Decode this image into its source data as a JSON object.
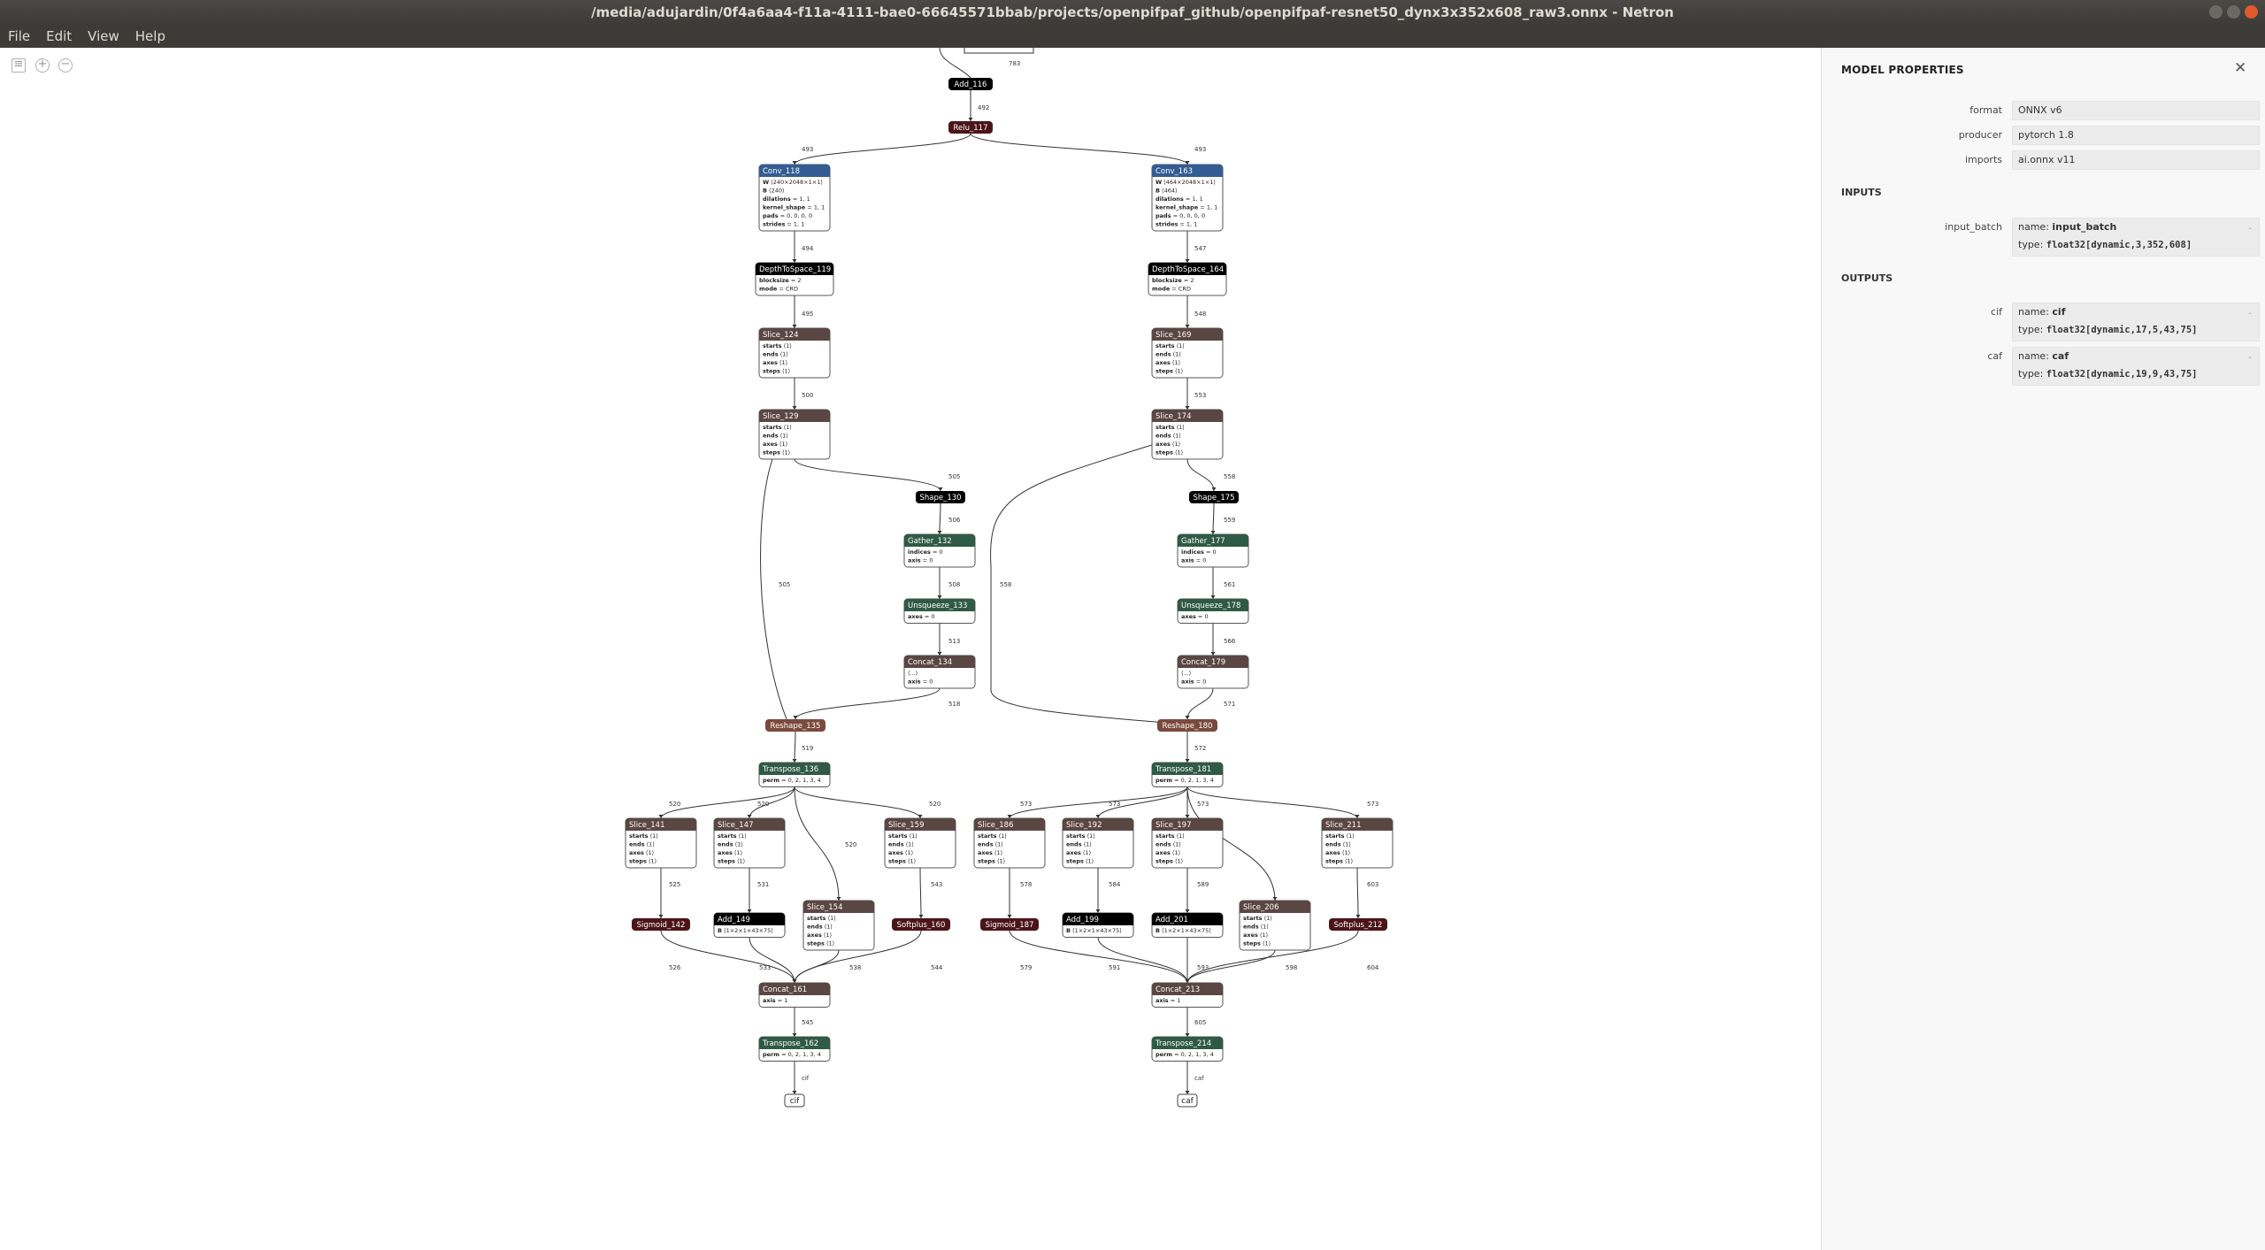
{
  "window": {
    "title": "/media/adujardin/0f4a6aa4-f11a-4111-bae0-66645571bbab/projects/openpifpaf_github/openpifpaf-resnet50_dynx3x352x608_raw3.onnx - Netron"
  },
  "menu": [
    "File",
    "Edit",
    "View",
    "Help"
  ],
  "colors": {
    "layer": "#335c93",
    "shape": "#7a4a3d",
    "tensor": "#2f5a45",
    "activation": "#4b1518",
    "black": "#000000",
    "dark": "#5a4642"
  },
  "graph": {
    "nodes": [
      {
        "id": "add116",
        "label": "Add_116",
        "kind": "black",
        "attrs": []
      },
      {
        "id": "relu117",
        "label": "Relu_117",
        "kind": "activation",
        "attrs": []
      },
      {
        "id": "conv118",
        "label": "Conv_118",
        "kind": "layer",
        "attrs": [
          [
            "W",
            "⟨240×2048×1×1⟩"
          ],
          [
            "B",
            "⟨240⟩"
          ],
          [
            "dilations",
            "1, 1"
          ],
          [
            "kernel_shape",
            "1, 1"
          ],
          [
            "pads",
            "0, 0, 0, 0"
          ],
          [
            "strides",
            "1, 1"
          ]
        ]
      },
      {
        "id": "conv163",
        "label": "Conv_163",
        "kind": "layer",
        "attrs": [
          [
            "W",
            "⟨464×2048×1×1⟩"
          ],
          [
            "B",
            "⟨464⟩"
          ],
          [
            "dilations",
            "1, 1"
          ],
          [
            "kernel_shape",
            "1, 1"
          ],
          [
            "pads",
            "0, 0, 0, 0"
          ],
          [
            "strides",
            "1, 1"
          ]
        ]
      },
      {
        "id": "d2s119",
        "label": "DepthToSpace_119",
        "kind": "black",
        "attrs": [
          [
            "blocksize",
            "2"
          ],
          [
            "mode",
            "CRD"
          ]
        ]
      },
      {
        "id": "d2s164",
        "label": "DepthToSpace_164",
        "kind": "black",
        "attrs": [
          [
            "blocksize",
            "2"
          ],
          [
            "mode",
            "CRD"
          ]
        ]
      },
      {
        "id": "slice124",
        "label": "Slice_124",
        "kind": "dark",
        "attrs": [
          [
            "starts",
            "⟨1⟩"
          ],
          [
            "ends",
            "⟨1⟩"
          ],
          [
            "axes",
            "⟨1⟩"
          ],
          [
            "steps",
            "⟨1⟩"
          ]
        ]
      },
      {
        "id": "slice169",
        "label": "Slice_169",
        "kind": "dark",
        "attrs": [
          [
            "starts",
            "⟨1⟩"
          ],
          [
            "ends",
            "⟨1⟩"
          ],
          [
            "axes",
            "⟨1⟩"
          ],
          [
            "steps",
            "⟨1⟩"
          ]
        ]
      },
      {
        "id": "slice129",
        "label": "Slice_129",
        "kind": "dark",
        "attrs": [
          [
            "starts",
            "⟨1⟩"
          ],
          [
            "ends",
            "⟨1⟩"
          ],
          [
            "axes",
            "⟨1⟩"
          ],
          [
            "steps",
            "⟨1⟩"
          ]
        ]
      },
      {
        "id": "slice174",
        "label": "Slice_174",
        "kind": "dark",
        "attrs": [
          [
            "starts",
            "⟨1⟩"
          ],
          [
            "ends",
            "⟨1⟩"
          ],
          [
            "axes",
            "⟨1⟩"
          ],
          [
            "steps",
            "⟨1⟩"
          ]
        ]
      },
      {
        "id": "shape130",
        "label": "Shape_130",
        "kind": "black",
        "attrs": []
      },
      {
        "id": "shape175",
        "label": "Shape_175",
        "kind": "black",
        "attrs": []
      },
      {
        "id": "gather132",
        "label": "Gather_132",
        "kind": "tensor",
        "attrs": [
          [
            "indices",
            "0"
          ],
          [
            "axis",
            "0"
          ]
        ]
      },
      {
        "id": "gather177",
        "label": "Gather_177",
        "kind": "tensor",
        "attrs": [
          [
            "indices",
            "0"
          ],
          [
            "axis",
            "0"
          ]
        ]
      },
      {
        "id": "unsq133",
        "label": "Unsqueeze_133",
        "kind": "tensor",
        "attrs": [
          [
            "axes",
            "0"
          ]
        ]
      },
      {
        "id": "unsq178",
        "label": "Unsqueeze_178",
        "kind": "tensor",
        "attrs": [
          [
            "axes",
            "0"
          ]
        ]
      },
      {
        "id": "concat134",
        "label": "Concat_134",
        "kind": "dark",
        "attrs": [
          [
            "",
            "⟨...⟩"
          ],
          [
            "axis",
            "0"
          ]
        ]
      },
      {
        "id": "concat179",
        "label": "Concat_179",
        "kind": "dark",
        "attrs": [
          [
            "",
            "⟨...⟩"
          ],
          [
            "axis",
            "0"
          ]
        ]
      },
      {
        "id": "reshape135",
        "label": "Reshape_135",
        "kind": "shape",
        "attrs": []
      },
      {
        "id": "reshape180",
        "label": "Reshape_180",
        "kind": "shape",
        "attrs": []
      },
      {
        "id": "transpose136",
        "label": "Transpose_136",
        "kind": "tensor",
        "attrs": [
          [
            "perm",
            "0, 2, 1, 3, 4"
          ]
        ]
      },
      {
        "id": "transpose181",
        "label": "Transpose_181",
        "kind": "tensor",
        "attrs": [
          [
            "perm",
            "0, 2, 1, 3, 4"
          ]
        ]
      },
      {
        "id": "slice141",
        "label": "Slice_141",
        "kind": "dark",
        "attrs": [
          [
            "starts",
            "⟨1⟩"
          ],
          [
            "ends",
            "⟨1⟩"
          ],
          [
            "axes",
            "⟨1⟩"
          ],
          [
            "steps",
            "⟨1⟩"
          ]
        ]
      },
      {
        "id": "slice147",
        "label": "Slice_147",
        "kind": "dark",
        "attrs": [
          [
            "starts",
            "⟨1⟩"
          ],
          [
            "ends",
            "⟨1⟩"
          ],
          [
            "axes",
            "⟨1⟩"
          ],
          [
            "steps",
            "⟨1⟩"
          ]
        ]
      },
      {
        "id": "slice159",
        "label": "Slice_159",
        "kind": "dark",
        "attrs": [
          [
            "starts",
            "⟨1⟩"
          ],
          [
            "ends",
            "⟨1⟩"
          ],
          [
            "axes",
            "⟨1⟩"
          ],
          [
            "steps",
            "⟨1⟩"
          ]
        ]
      },
      {
        "id": "slice154",
        "label": "Slice_154",
        "kind": "dark",
        "attrs": [
          [
            "starts",
            "⟨1⟩"
          ],
          [
            "ends",
            "⟨1⟩"
          ],
          [
            "axes",
            "⟨1⟩"
          ],
          [
            "steps",
            "⟨1⟩"
          ]
        ]
      },
      {
        "id": "slice186",
        "label": "Slice_186",
        "kind": "dark",
        "attrs": [
          [
            "starts",
            "⟨1⟩"
          ],
          [
            "ends",
            "⟨1⟩"
          ],
          [
            "axes",
            "⟨1⟩"
          ],
          [
            "steps",
            "⟨1⟩"
          ]
        ]
      },
      {
        "id": "slice192",
        "label": "Slice_192",
        "kind": "dark",
        "attrs": [
          [
            "starts",
            "⟨1⟩"
          ],
          [
            "ends",
            "⟨1⟩"
          ],
          [
            "axes",
            "⟨1⟩"
          ],
          [
            "steps",
            "⟨1⟩"
          ]
        ]
      },
      {
        "id": "slice197",
        "label": "Slice_197",
        "kind": "dark",
        "attrs": [
          [
            "starts",
            "⟨1⟩"
          ],
          [
            "ends",
            "⟨1⟩"
          ],
          [
            "axes",
            "⟨1⟩"
          ],
          [
            "steps",
            "⟨1⟩"
          ]
        ]
      },
      {
        "id": "slice211",
        "label": "Slice_211",
        "kind": "dark",
        "attrs": [
          [
            "starts",
            "⟨1⟩"
          ],
          [
            "ends",
            "⟨1⟩"
          ],
          [
            "axes",
            "⟨1⟩"
          ],
          [
            "steps",
            "⟨1⟩"
          ]
        ]
      },
      {
        "id": "slice206",
        "label": "Slice_206",
        "kind": "dark",
        "attrs": [
          [
            "starts",
            "⟨1⟩"
          ],
          [
            "ends",
            "⟨1⟩"
          ],
          [
            "axes",
            "⟨1⟩"
          ],
          [
            "steps",
            "⟨1⟩"
          ]
        ]
      },
      {
        "id": "sigmoid142",
        "label": "Sigmoid_142",
        "kind": "activation",
        "attrs": []
      },
      {
        "id": "add149",
        "label": "Add_149",
        "kind": "black",
        "attrs": [
          [
            "B",
            "⟨1×2×1×43×75⟩"
          ]
        ]
      },
      {
        "id": "softplus160",
        "label": "Softplus_160",
        "kind": "activation",
        "attrs": []
      },
      {
        "id": "sigmoid187",
        "label": "Sigmoid_187",
        "kind": "activation",
        "attrs": []
      },
      {
        "id": "add199",
        "label": "Add_199",
        "kind": "black",
        "attrs": [
          [
            "B",
            "⟨1×2×1×43×75⟩"
          ]
        ]
      },
      {
        "id": "add201",
        "label": "Add_201",
        "kind": "black",
        "attrs": [
          [
            "B",
            "⟨1×2×1×43×75⟩"
          ]
        ]
      },
      {
        "id": "softplus212",
        "label": "Softplus_212",
        "kind": "activation",
        "attrs": []
      },
      {
        "id": "concat161",
        "label": "Concat_161",
        "kind": "dark",
        "attrs": [
          [
            "axis",
            "1"
          ]
        ]
      },
      {
        "id": "concat213",
        "label": "Concat_213",
        "kind": "dark",
        "attrs": [
          [
            "axis",
            "1"
          ]
        ]
      },
      {
        "id": "transpose162",
        "label": "Transpose_162",
        "kind": "tensor",
        "attrs": [
          [
            "perm",
            "0, 2, 1, 3, 4"
          ]
        ]
      },
      {
        "id": "transpose214",
        "label": "Transpose_214",
        "kind": "tensor",
        "attrs": [
          [
            "perm",
            "0, 2, 1, 3, 4"
          ]
        ]
      },
      {
        "id": "out_cif",
        "label": "cif",
        "kind": "output",
        "attrs": []
      },
      {
        "id": "out_caf",
        "label": "caf",
        "kind": "output",
        "attrs": []
      }
    ],
    "edge_labels": [
      "783",
      "492",
      "493",
      "493",
      "494",
      "547",
      "495",
      "548",
      "500",
      "553",
      "505",
      "558",
      "506",
      "559",
      "508",
      "561",
      "513",
      "566",
      "518",
      "571",
      "505",
      "558",
      "519",
      "572",
      "520",
      "520",
      "520",
      "520",
      "573",
      "573",
      "573",
      "573",
      "525",
      "531",
      "543",
      "578",
      "584",
      "589",
      "603",
      "526",
      "533",
      "538",
      "544",
      "579",
      "591",
      "593",
      "598",
      "604",
      "545",
      "605",
      "cif",
      "caf"
    ]
  },
  "panel": {
    "title": "MODEL PROPERTIES",
    "close": "✕",
    "properties": [
      {
        "label": "format",
        "value": "ONNX v6"
      },
      {
        "label": "producer",
        "value": "pytorch 1.8"
      },
      {
        "label": "imports",
        "value": "ai.onnx v11"
      }
    ],
    "inputs_heading": "INPUTS",
    "inputs": [
      {
        "label": "input_batch",
        "name_prefix": "name: ",
        "name": "input_batch",
        "type_prefix": "type: ",
        "type": "float32[dynamic,3,352,608]"
      }
    ],
    "outputs_heading": "OUTPUTS",
    "outputs": [
      {
        "label": "cif",
        "name_prefix": "name: ",
        "name": "cif",
        "type_prefix": "type: ",
        "type": "float32[dynamic,17,5,43,75]"
      },
      {
        "label": "caf",
        "name_prefix": "name: ",
        "name": "caf",
        "type_prefix": "type: ",
        "type": "float32[dynamic,19,9,43,75]"
      }
    ]
  }
}
